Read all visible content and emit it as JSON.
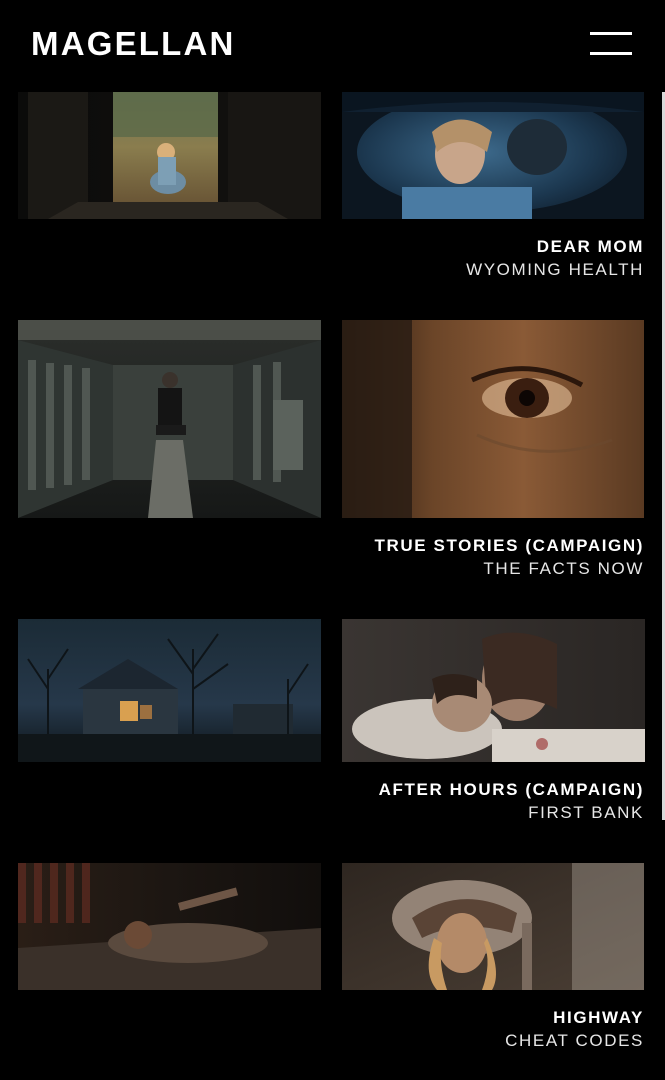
{
  "header": {
    "logo": "MAGELLAN",
    "menu_icon": "hamburger-menu-icon"
  },
  "projects": [
    {
      "title": "DEAR MOM",
      "client": "WYOMING HEALTH",
      "stills": [
        "Girl sitting outside a doorway, seen from a dark hallway",
        "Woman in blue lying down, framed through a curved opening"
      ]
    },
    {
      "title": "TRUE STORIES (CAMPAIGN)",
      "client": "THE FACTS NOW",
      "stills": [
        "Teen boy sitting alone on a bench in a locker room",
        "Close-up of a person's eye"
      ]
    },
    {
      "title": "AFTER HOURS (CAMPAIGN)",
      "client": "FIRST BANK",
      "stills": [
        "House at night with a lit window under bare trees",
        "Couple kissing in bed"
      ]
    },
    {
      "title": "HIGHWAY",
      "client": "CHEAT CODES",
      "stills": [
        "Man lying on a bed in a dim room",
        "Woman in a white cowboy hat"
      ]
    }
  ]
}
